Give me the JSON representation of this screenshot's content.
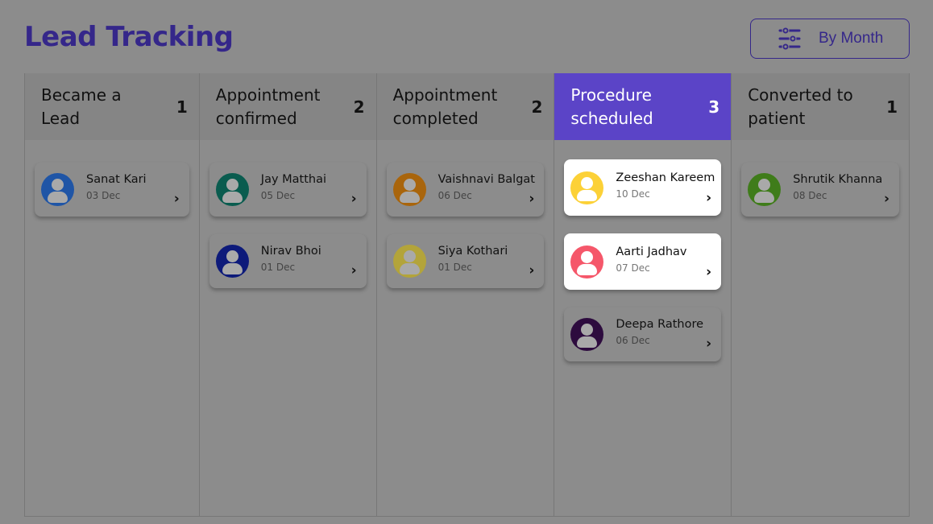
{
  "header": {
    "title": "Lead Tracking",
    "filter_label": "By Month",
    "filter_icon": "sliders-icon"
  },
  "colors": {
    "accent": "#5b44c7",
    "title": "#35278a",
    "background": "#8c8c8c"
  },
  "columns": [
    {
      "title": "Became a Lead",
      "count": "1",
      "active": false,
      "cards": [
        {
          "name": "Sanat Kari",
          "date": "03 Dec",
          "avatar_color": "#1f55a6",
          "highlight": false
        }
      ]
    },
    {
      "title": "Appointment confirmed",
      "count": "2",
      "active": false,
      "cards": [
        {
          "name": "Jay Matthai",
          "date": "05 Dec",
          "avatar_color": "#0a5c4f",
          "highlight": false
        },
        {
          "name": "Nirav Bhoi",
          "date": "01 Dec",
          "avatar_color": "#0d1a7a",
          "highlight": false
        }
      ]
    },
    {
      "title": "Appointment completed",
      "count": "2",
      "active": false,
      "cards": [
        {
          "name": "Vaishnavi Balgat",
          "date": "06 Dec",
          "avatar_color": "#a9650c",
          "highlight": false
        },
        {
          "name": "Siya Kothari",
          "date": "01 Dec",
          "avatar_color": "#b3a43a",
          "highlight": false
        }
      ]
    },
    {
      "title": "Procedure scheduled",
      "count": "3",
      "active": true,
      "cards": [
        {
          "name": "Zeeshan Kareem",
          "date": "10 Dec",
          "avatar_color": "#fcd137",
          "highlight": true
        },
        {
          "name": "Aarti Jadhav",
          "date": "07 Dec",
          "avatar_color": "#f5576a",
          "highlight": true
        },
        {
          "name": "Deepa Rathore",
          "date": "06 Dec",
          "avatar_color": "#2d0b3e",
          "highlight": false
        }
      ]
    },
    {
      "title": "Converted to patient",
      "count": "1",
      "active": false,
      "cards": [
        {
          "name": "Shrutik Khanna",
          "date": "08 Dec",
          "avatar_color": "#3f7c1a",
          "highlight": false
        }
      ]
    }
  ],
  "card_chevron": "›"
}
